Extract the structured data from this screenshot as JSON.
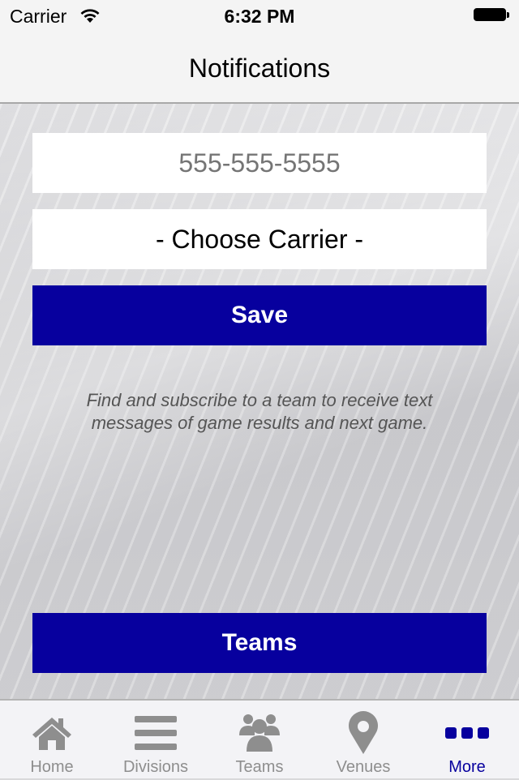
{
  "status_bar": {
    "carrier": "Carrier",
    "time": "6:32 PM"
  },
  "nav": {
    "title": "Notifications"
  },
  "form": {
    "phone_placeholder": "555-555-5555",
    "phone_value": "",
    "carrier_selected": "- Choose Carrier -",
    "save_label": "Save"
  },
  "info_text": "Find and subscribe to a team to receive text messages of game results and next game.",
  "teams_button_label": "Teams",
  "colors": {
    "accent": "#07009e",
    "inactive": "#8e8e8e"
  },
  "tabs": [
    {
      "label": "Home",
      "icon": "home-icon",
      "active": false
    },
    {
      "label": "Divisions",
      "icon": "list-icon",
      "active": false
    },
    {
      "label": "Teams",
      "icon": "group-icon",
      "active": false
    },
    {
      "label": "Venues",
      "icon": "map-pin-icon",
      "active": false
    },
    {
      "label": "More",
      "icon": "more-icon",
      "active": true
    }
  ]
}
